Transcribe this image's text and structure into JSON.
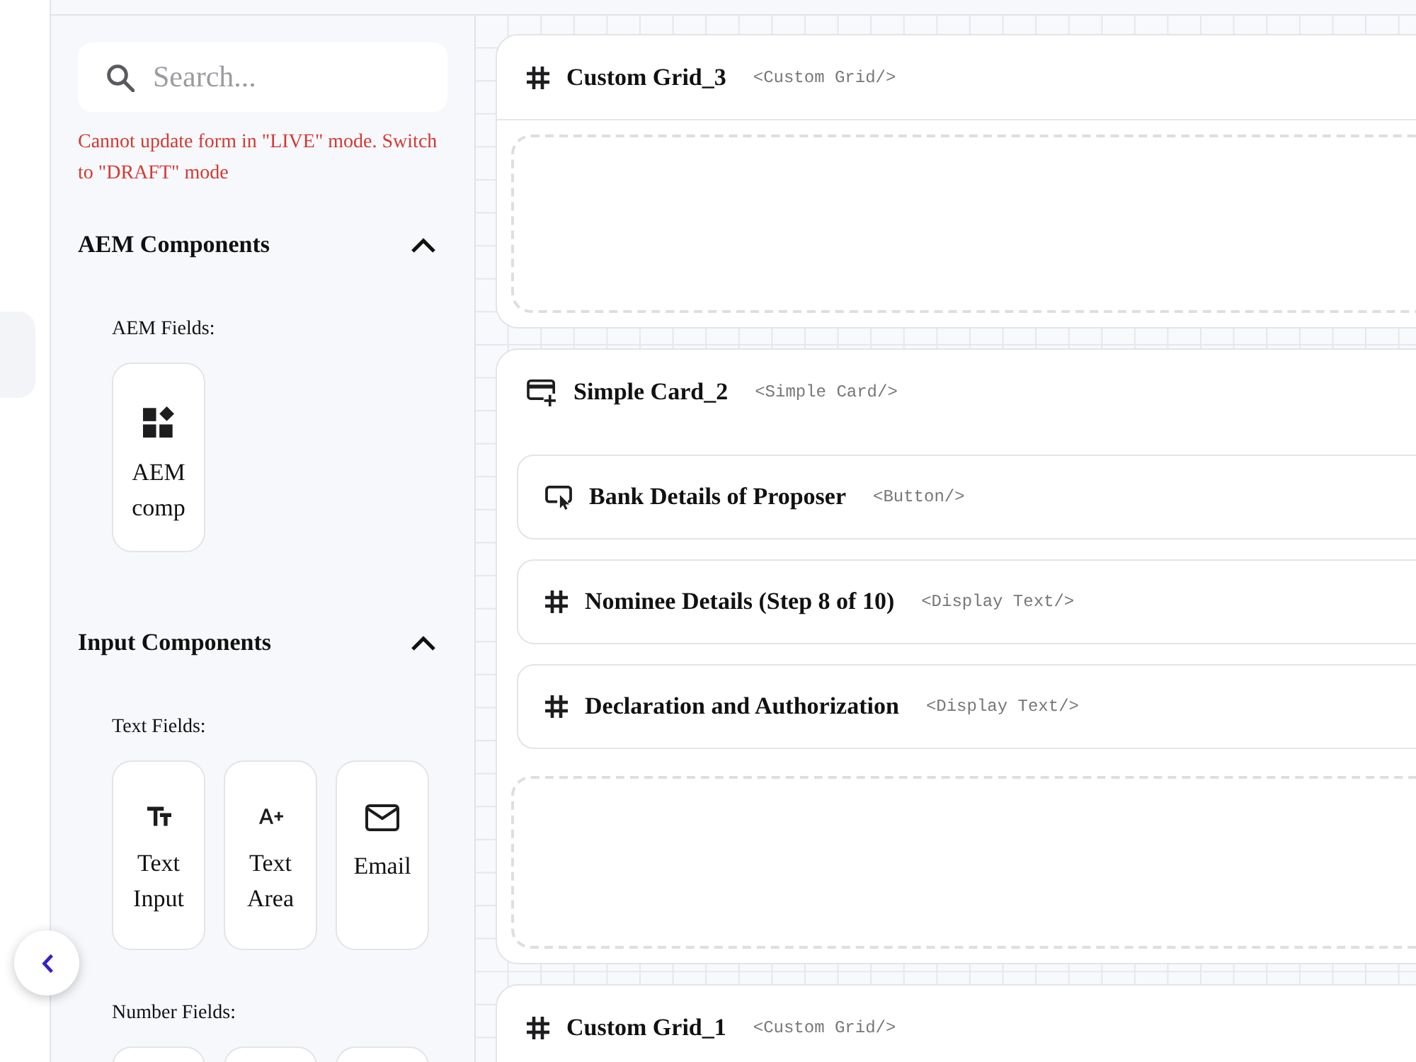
{
  "sidebar": {
    "search": {
      "placeholder": "Search..."
    },
    "error": "Cannot update form in \"LIVE\" mode. Switch to \"DRAFT\" mode",
    "sections": [
      {
        "title": "AEM Components",
        "expanded": true,
        "groups": [
          {
            "label": "AEM Fields:",
            "items": [
              {
                "kind": "aem",
                "label": "AEM comp"
              }
            ]
          }
        ]
      },
      {
        "title": "Input Components",
        "expanded": true,
        "groups": [
          {
            "label": "Text Fields:",
            "items": [
              {
                "kind": "text-input",
                "label": "Text Input"
              },
              {
                "kind": "text-area",
                "label": "Text Area"
              },
              {
                "kind": "email",
                "label": "Email"
              }
            ]
          },
          {
            "label": "Number Fields:",
            "items": [
              {
                "kind": "cut-off"
              },
              {
                "kind": "cut-off"
              },
              {
                "kind": "cut-off"
              }
            ]
          }
        ]
      }
    ]
  },
  "canvas": {
    "components": [
      {
        "kind": "grid",
        "title": "Custom Grid_3",
        "tag": "<Custom Grid/>"
      },
      {
        "kind": "card",
        "title": "Simple Card_2",
        "tag": "<Simple Card/>",
        "children": [
          {
            "kind": "button",
            "title": "Bank Details of Proposer",
            "tag": "<Button/>"
          },
          {
            "kind": "display-text",
            "title": "Nominee Details (Step 8 of 10)",
            "tag": "<Display Text/>"
          },
          {
            "kind": "display-text",
            "title": "Declaration and Authorization",
            "tag": "<Display Text/>"
          }
        ]
      },
      {
        "kind": "grid",
        "title": "Custom Grid_1",
        "tag": "<Custom Grid/>"
      }
    ]
  }
}
